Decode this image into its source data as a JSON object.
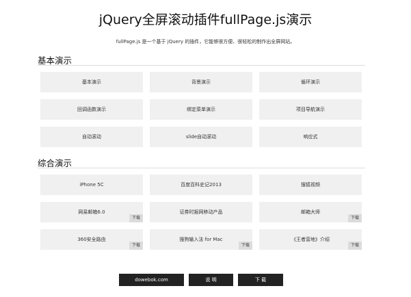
{
  "header": {
    "title": "jQuery全屏滚动插件fullPage.js演示",
    "subtitle": "fullPage.js 是一个基于 jQuery 的插件，它能够很方便、很轻松的制作出全屏网站。"
  },
  "basic": {
    "heading": "基本演示",
    "items": [
      {
        "label": "基本演示"
      },
      {
        "label": "背景演示"
      },
      {
        "label": "循环演示"
      },
      {
        "label": "回调函数演示"
      },
      {
        "label": "绑定菜单演示"
      },
      {
        "label": "项目导航演示"
      },
      {
        "label": "自动滚动"
      },
      {
        "label": "slide自动滚动"
      },
      {
        "label": "响应式"
      }
    ]
  },
  "combined": {
    "heading": "综合演示",
    "download_label": "下载",
    "items": [
      {
        "label": "iPhone 5C"
      },
      {
        "label": "百度百科史记2013"
      },
      {
        "label": "搜狐视频"
      },
      {
        "label": "网易邮箱6.0"
      },
      {
        "label": "证券时报网移动产品"
      },
      {
        "label": "邮箱大师"
      },
      {
        "label": "360安全路由"
      },
      {
        "label": "搜狗输入法 for Mac"
      },
      {
        "label": "《王者营地》介绍"
      }
    ]
  },
  "footer": {
    "site_label": "dowebok.com",
    "help_label": "说 明",
    "download_label": "下 载"
  }
}
